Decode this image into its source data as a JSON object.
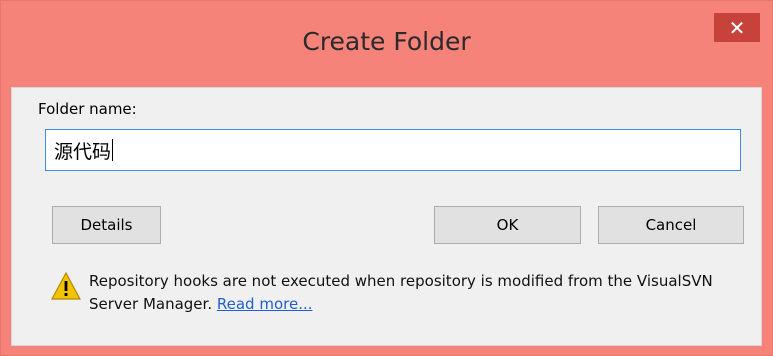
{
  "dialog": {
    "title": "Create Folder",
    "close_glyph": "✕",
    "folder_label": "Folder name:",
    "folder_value": "源代码",
    "buttons": {
      "details": "Details",
      "ok": "OK",
      "cancel": "Cancel"
    },
    "warning": {
      "text": "Repository hooks are not executed when repository is modified from the VisualSVN Server Manager.",
      "link": "Read more..."
    }
  },
  "colors": {
    "titlebar": "#f5837a",
    "close_button": "#c7423a",
    "client_bg": "#f0f0f0",
    "input_border": "#3c8de8",
    "link": "#1f5fd1"
  },
  "icons": {
    "close": "close-icon",
    "warning": "warning-icon"
  }
}
